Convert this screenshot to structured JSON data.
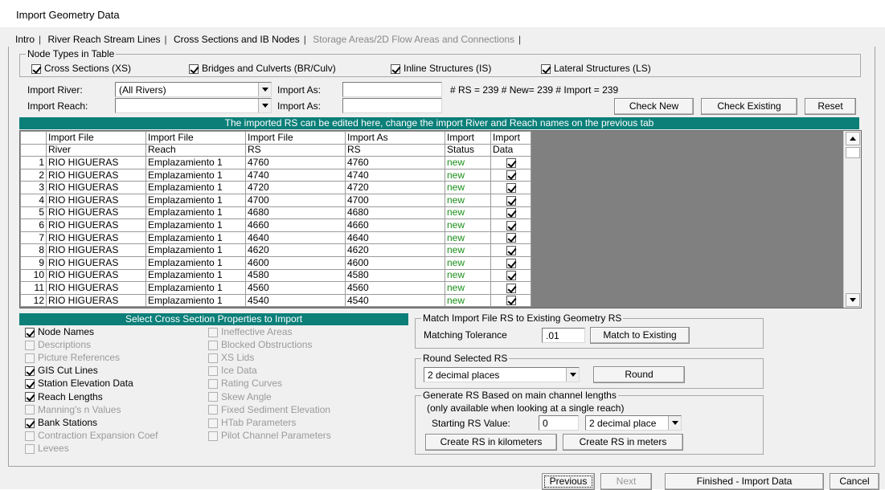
{
  "window": {
    "title": "Import Geometry Data"
  },
  "tabs": [
    {
      "label": "Intro",
      "state": "normal"
    },
    {
      "label": "River Reach Stream Lines",
      "state": "normal"
    },
    {
      "label": "Cross Sections and IB Nodes",
      "state": "active"
    },
    {
      "label": "Storage Areas/2D Flow Areas and Connections",
      "state": "disabled"
    }
  ],
  "node_types": {
    "legend": "Node Types in Table",
    "items": [
      {
        "label": "Cross Sections (XS)",
        "checked": true
      },
      {
        "label": "Bridges and Culverts (BR/Culv)",
        "checked": true
      },
      {
        "label": "Inline Structures (IS)",
        "checked": true
      },
      {
        "label": "Lateral Structures (LS)",
        "checked": true
      }
    ]
  },
  "import": {
    "river_label": "Import River:",
    "river_value": "(All Rivers)",
    "reach_label": "Import Reach:",
    "reach_value": "",
    "import_as_label": "Import As:",
    "river_import_as": "",
    "reach_import_as": "",
    "counts": "# RS = 239  # New= 239  # Import = 239"
  },
  "buttons": {
    "check_new": "Check New",
    "check_existing": "Check Existing",
    "reset": "Reset",
    "match_to_existing": "Match to Existing",
    "round": "Round",
    "create_km": "Create RS in kilometers",
    "create_m": "Create RS in meters",
    "previous": "Previous",
    "next": "Next",
    "finished": "Finished - Import Data",
    "cancel": "Cancel"
  },
  "table": {
    "banner": "The imported RS can be edited here, change the import River and Reach names on the previous tab",
    "header1": [
      "Import File",
      "Import File",
      "Import File",
      "Import As",
      "Import",
      "Import"
    ],
    "header2": [
      "River",
      "Reach",
      "RS",
      "RS",
      "Status",
      "Data"
    ],
    "rows": [
      {
        "n": "1",
        "river": "RIO HIGUERAS",
        "reach": "Emplazamiento 1",
        "rs": "4760",
        "as": "4760",
        "status": "new",
        "data": true
      },
      {
        "n": "2",
        "river": "RIO HIGUERAS",
        "reach": "Emplazamiento 1",
        "rs": "4740",
        "as": "4740",
        "status": "new",
        "data": true
      },
      {
        "n": "3",
        "river": "RIO HIGUERAS",
        "reach": "Emplazamiento 1",
        "rs": "4720",
        "as": "4720",
        "status": "new",
        "data": true
      },
      {
        "n": "4",
        "river": "RIO HIGUERAS",
        "reach": "Emplazamiento 1",
        "rs": "4700",
        "as": "4700",
        "status": "new",
        "data": true
      },
      {
        "n": "5",
        "river": "RIO HIGUERAS",
        "reach": "Emplazamiento 1",
        "rs": "4680",
        "as": "4680",
        "status": "new",
        "data": true
      },
      {
        "n": "6",
        "river": "RIO HIGUERAS",
        "reach": "Emplazamiento 1",
        "rs": "4660",
        "as": "4660",
        "status": "new",
        "data": true
      },
      {
        "n": "7",
        "river": "RIO HIGUERAS",
        "reach": "Emplazamiento 1",
        "rs": "4640",
        "as": "4640",
        "status": "new",
        "data": true
      },
      {
        "n": "8",
        "river": "RIO HIGUERAS",
        "reach": "Emplazamiento 1",
        "rs": "4620",
        "as": "4620",
        "status": "new",
        "data": true
      },
      {
        "n": "9",
        "river": "RIO HIGUERAS",
        "reach": "Emplazamiento 1",
        "rs": "4600",
        "as": "4600",
        "status": "new",
        "data": true
      },
      {
        "n": "10",
        "river": "RIO HIGUERAS",
        "reach": "Emplazamiento 1",
        "rs": "4580",
        "as": "4580",
        "status": "new",
        "data": true
      },
      {
        "n": "11",
        "river": "RIO HIGUERAS",
        "reach": "Emplazamiento 1",
        "rs": "4560",
        "as": "4560",
        "status": "new",
        "data": true
      },
      {
        "n": "12",
        "river": "RIO HIGUERAS",
        "reach": "Emplazamiento 1",
        "rs": "4540",
        "as": "4540",
        "status": "new",
        "data": true
      }
    ]
  },
  "properties": {
    "header": "Select Cross Section Properties to Import",
    "col1": [
      {
        "label": "Node Names",
        "checked": true,
        "enabled": true
      },
      {
        "label": "Descriptions",
        "checked": false,
        "enabled": false
      },
      {
        "label": "Picture References",
        "checked": false,
        "enabled": false
      },
      {
        "label": "GIS Cut Lines",
        "checked": true,
        "enabled": true
      },
      {
        "label": "Station Elevation Data",
        "checked": true,
        "enabled": true
      },
      {
        "label": "Reach Lengths",
        "checked": true,
        "enabled": true
      },
      {
        "label": "Manning's n Values",
        "checked": false,
        "enabled": false
      },
      {
        "label": "Bank Stations",
        "checked": true,
        "enabled": true
      },
      {
        "label": "Contraction Expansion Coef",
        "checked": false,
        "enabled": false
      },
      {
        "label": "Levees",
        "checked": false,
        "enabled": false
      }
    ],
    "col2": [
      {
        "label": "Ineffective Areas",
        "checked": false,
        "enabled": false
      },
      {
        "label": "Blocked Obstructions",
        "checked": false,
        "enabled": false
      },
      {
        "label": "XS Lids",
        "checked": false,
        "enabled": false
      },
      {
        "label": "Ice Data",
        "checked": false,
        "enabled": false
      },
      {
        "label": "Rating Curves",
        "checked": false,
        "enabled": false
      },
      {
        "label": "Skew Angle",
        "checked": false,
        "enabled": false
      },
      {
        "label": "Fixed Sediment Elevation",
        "checked": false,
        "enabled": false
      },
      {
        "label": "HTab Parameters",
        "checked": false,
        "enabled": false
      },
      {
        "label": "Pilot Channel Parameters",
        "checked": false,
        "enabled": false
      }
    ]
  },
  "match": {
    "legend": "Match Import File RS to Existing Geometry RS",
    "tolerance_label": "Matching Tolerance",
    "tolerance_value": ".01"
  },
  "round": {
    "legend": "Round Selected RS",
    "selected": "2 decimal places"
  },
  "generate": {
    "legend": "Generate RS Based on main channel lengths",
    "note": "(only available when looking at a single reach)",
    "start_label": "Starting RS  Value:",
    "start_value": "0",
    "decimals": "2 decimal place"
  }
}
